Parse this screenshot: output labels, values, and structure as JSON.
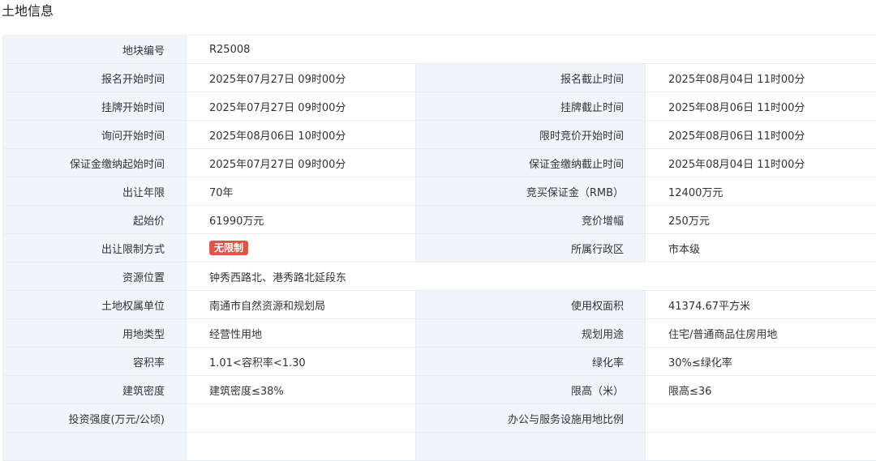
{
  "section_title": "土地信息",
  "rows": [
    {
      "type": "single",
      "key": "地块编号",
      "value": "R25008"
    },
    {
      "type": "pair",
      "key1": "报名开始时间",
      "value1": "2025年07月27日 09时00分",
      "key2": "报名截止时间",
      "value2": "2025年08月04日 11时00分"
    },
    {
      "type": "pair",
      "key1": "挂牌开始时间",
      "value1": "2025年07月27日 09时00分",
      "key2": "挂牌截止时间",
      "value2": "2025年08月06日 11时00分"
    },
    {
      "type": "pair",
      "key1": "询问开始时间",
      "value1": "2025年08月06日 10时00分",
      "key2": "限时竞价开始时间",
      "value2": "2025年08月06日 11时00分"
    },
    {
      "type": "pair",
      "key1": "保证金缴纳起始时间",
      "value1": "2025年07月27日 09时00分",
      "key2": "保证金缴纳截止时间",
      "value2": "2025年08月04日 11时00分"
    },
    {
      "type": "pair",
      "key1": "出让年限",
      "value1": "70年",
      "key2": "竞买保证金（RMB）",
      "value2": "12400万元"
    },
    {
      "type": "pair",
      "key1": "起始价",
      "value1": "61990万元",
      "key2": "竞价增幅",
      "value2": "250万元"
    },
    {
      "type": "pair",
      "key1": "出让限制方式",
      "value1": "无限制",
      "badge": true,
      "badge_color": "#e05447",
      "key2": "所属行政区",
      "value2": "市本级"
    },
    {
      "type": "single",
      "key": "资源位置",
      "value": "钟秀西路北、港秀路北延段东"
    },
    {
      "type": "pair",
      "key1": "土地权属单位",
      "value1": "南通市自然资源和规划局",
      "key2": "使用权面积",
      "value2": "41374.67平方米"
    },
    {
      "type": "pair",
      "key1": "用地类型",
      "value1": "经营性用地",
      "key2": "规划用途",
      "value2": "住宅/普通商品住房用地"
    },
    {
      "type": "pair",
      "key1": "容积率",
      "value1": "1.01<容积率<1.30",
      "key2": "绿化率",
      "value2": "30%≤绿化率"
    },
    {
      "type": "pair",
      "key1": "建筑密度",
      "value1": "建筑密度≤38%",
      "key2": "限高（米）",
      "value2": "限高≤36"
    },
    {
      "type": "pair",
      "key1": "投资强度(万元/公顷)",
      "value1": "",
      "key2": "办公与服务设施用地比例",
      "value2": ""
    },
    {
      "type": "pair",
      "key1": "",
      "value1": "",
      "key2": "",
      "value2": ""
    }
  ],
  "colors": {
    "key_bg": "#eef6fc",
    "border": "#e8edf3",
    "badge": "#e05447"
  }
}
